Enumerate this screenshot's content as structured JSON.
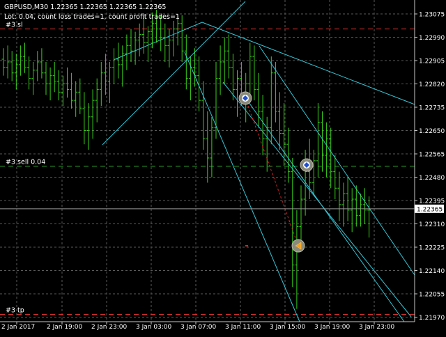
{
  "header": {
    "symbol_line": "GBPUSD,M30  1.22365 1.22365 1.22365 1.22365",
    "info_line": "Lot: 0.04, count loss trades=1, count profit trades=1"
  },
  "levels": {
    "sl_label": "#3 sl",
    "sell_label": "#3 sell 0.04",
    "tp_label": "#3 tp",
    "sl_price": 1.2302,
    "sell_price": 1.2252,
    "tp_price": 1.2198
  },
  "current_price": "1.22365",
  "colors": {
    "background": "#000000",
    "grid": "#5a5a5a",
    "candle": "#37d21a",
    "trendline": "#33c6d6",
    "stop_loss": "#e03030",
    "sell_level": "#2fb02f",
    "text": "#ffffff",
    "trade_path": "#e02020"
  },
  "chart_data": {
    "type": "ohlc_bar",
    "symbol": "GBPUSD",
    "timeframe": "M30",
    "price_axis_ticks": [
      "1.23075",
      "1.22990",
      "1.22905",
      "1.22820",
      "1.22735",
      "1.22650",
      "1.22565",
      "1.22480",
      "1.22395",
      "1.22310",
      "1.22225",
      "1.22140",
      "1.22055",
      "1.21970"
    ],
    "time_axis_ticks": [
      "2 Jan 2017",
      "2 Jan 19:00",
      "2 Jan 23:00",
      "3 Jan 03:00",
      "3 Jan 07:00",
      "3 Jan 11:00",
      "3 Jan 15:00",
      "3 Jan 19:00",
      "3 Jan 23:00"
    ],
    "ylim": [
      1.2193,
      1.2313
    ],
    "bars": [
      [
        1.2291,
        1.2295,
        1.2285,
        1.2288
      ],
      [
        1.2288,
        1.2296,
        1.2284,
        1.229
      ],
      [
        1.229,
        1.2294,
        1.2283,
        1.2286
      ],
      [
        1.2286,
        1.2293,
        1.228,
        1.2289
      ],
      [
        1.2289,
        1.2296,
        1.2285,
        1.2292
      ],
      [
        1.2292,
        1.2297,
        1.2286,
        1.2288
      ],
      [
        1.2288,
        1.2292,
        1.228,
        1.2284
      ],
      [
        1.2284,
        1.229,
        1.2278,
        1.2287
      ],
      [
        1.2287,
        1.2294,
        1.2283,
        1.229
      ],
      [
        1.229,
        1.2295,
        1.2284,
        1.2286
      ],
      [
        1.2286,
        1.229,
        1.2278,
        1.2282
      ],
      [
        1.2282,
        1.2288,
        1.2276,
        1.2285
      ],
      [
        1.2285,
        1.229,
        1.2279,
        1.2283
      ],
      [
        1.2283,
        1.2287,
        1.2276,
        1.2279
      ],
      [
        1.2279,
        1.2285,
        1.2274,
        1.2282
      ],
      [
        1.2282,
        1.2288,
        1.2277,
        1.228
      ],
      [
        1.228,
        1.2286,
        1.2273,
        1.2276
      ],
      [
        1.2276,
        1.2283,
        1.227,
        1.2279
      ],
      [
        1.2279,
        1.2284,
        1.2271,
        1.2273
      ],
      [
        1.2273,
        1.2279,
        1.226,
        1.2265
      ],
      [
        1.2265,
        1.2275,
        1.2258,
        1.227
      ],
      [
        1.227,
        1.228,
        1.2262,
        1.2276
      ],
      [
        1.2276,
        1.2284,
        1.2268,
        1.228
      ],
      [
        1.228,
        1.229,
        1.2274,
        1.2286
      ],
      [
        1.2286,
        1.2293,
        1.2278,
        1.2283
      ],
      [
        1.2283,
        1.229,
        1.2275,
        1.2288
      ],
      [
        1.2288,
        1.2295,
        1.2282,
        1.2291
      ],
      [
        1.2291,
        1.2297,
        1.2284,
        1.2289
      ],
      [
        1.2289,
        1.2296,
        1.2281,
        1.2293
      ],
      [
        1.2293,
        1.23,
        1.2287,
        1.2296
      ],
      [
        1.2296,
        1.2302,
        1.229,
        1.2294
      ],
      [
        1.2294,
        1.2301,
        1.2289,
        1.2298
      ],
      [
        1.2298,
        1.2304,
        1.2292,
        1.23
      ],
      [
        1.23,
        1.2306,
        1.2293,
        1.2297
      ],
      [
        1.2297,
        1.2303,
        1.229,
        1.2301
      ],
      [
        1.2301,
        1.2308,
        1.2295,
        1.2304
      ],
      [
        1.2304,
        1.2309,
        1.2297,
        1.2302
      ],
      [
        1.2302,
        1.2307,
        1.2294,
        1.2299
      ],
      [
        1.2299,
        1.2304,
        1.229,
        1.2296
      ],
      [
        1.2296,
        1.2302,
        1.2288,
        1.2298
      ],
      [
        1.2298,
        1.2305,
        1.2292,
        1.2302
      ],
      [
        1.2302,
        1.2307,
        1.2296,
        1.2304
      ],
      [
        1.2304,
        1.2307,
        1.229,
        1.2294
      ],
      [
        1.2294,
        1.23,
        1.228,
        1.2284
      ],
      [
        1.2284,
        1.2292,
        1.2276,
        1.2288
      ],
      [
        1.2288,
        1.2295,
        1.2281,
        1.2285
      ],
      [
        1.2285,
        1.2292,
        1.2272,
        1.2276
      ],
      [
        1.2276,
        1.2283,
        1.2258,
        1.2262
      ],
      [
        1.2262,
        1.2272,
        1.2246,
        1.2255
      ],
      [
        1.2255,
        1.227,
        1.2248,
        1.2266
      ],
      [
        1.2266,
        1.229,
        1.2262,
        1.2284
      ],
      [
        1.2284,
        1.2296,
        1.2278,
        1.229
      ],
      [
        1.229,
        1.2299,
        1.2282,
        1.2294
      ],
      [
        1.2294,
        1.23,
        1.2284,
        1.2288
      ],
      [
        1.2288,
        1.2293,
        1.2276,
        1.228
      ],
      [
        1.228,
        1.2287,
        1.227,
        1.2284
      ],
      [
        1.2284,
        1.229,
        1.2274,
        1.2278
      ],
      [
        1.2278,
        1.2286,
        1.2268,
        1.2282
      ],
      [
        1.2282,
        1.2297,
        1.2276,
        1.2292
      ],
      [
        1.2292,
        1.2296,
        1.2276,
        1.228
      ],
      [
        1.228,
        1.2286,
        1.2266,
        1.2272
      ],
      [
        1.2272,
        1.2278,
        1.2256,
        1.2262
      ],
      [
        1.2262,
        1.227,
        1.225,
        1.2266
      ],
      [
        1.2266,
        1.2292,
        1.226,
        1.2286
      ],
      [
        1.2286,
        1.229,
        1.2268,
        1.2272
      ],
      [
        1.2272,
        1.2279,
        1.2258,
        1.2264
      ],
      [
        1.2264,
        1.2275,
        1.2252,
        1.226
      ],
      [
        1.226,
        1.2266,
        1.2246,
        1.225
      ],
      [
        1.225,
        1.2255,
        1.2208,
        1.2216
      ],
      [
        1.2216,
        1.2236,
        1.22,
        1.223
      ],
      [
        1.223,
        1.2245,
        1.2222,
        1.224
      ],
      [
        1.224,
        1.2258,
        1.2234,
        1.225
      ],
      [
        1.225,
        1.2262,
        1.224,
        1.2246
      ],
      [
        1.2246,
        1.2258,
        1.2242,
        1.2254
      ],
      [
        1.2254,
        1.2275,
        1.2248,
        1.2268
      ],
      [
        1.2268,
        1.2272,
        1.225,
        1.2256
      ],
      [
        1.2256,
        1.2268,
        1.2248,
        1.2262
      ],
      [
        1.2262,
        1.2266,
        1.2244,
        1.225
      ],
      [
        1.225,
        1.2256,
        1.224,
        1.2244
      ],
      [
        1.2244,
        1.225,
        1.2232,
        1.2238
      ],
      [
        1.2238,
        1.2246,
        1.223,
        1.2242
      ],
      [
        1.2242,
        1.2248,
        1.2232,
        1.2236
      ],
      [
        1.2236,
        1.2244,
        1.2228,
        1.224
      ],
      [
        1.224,
        1.2245,
        1.223,
        1.2234
      ],
      [
        1.2234,
        1.2242,
        1.223,
        1.2238
      ],
      [
        1.2238,
        1.2244,
        1.2231,
        1.2236
      ],
      [
        1.2236,
        1.2241,
        1.2226,
        1.2236
      ]
    ]
  }
}
